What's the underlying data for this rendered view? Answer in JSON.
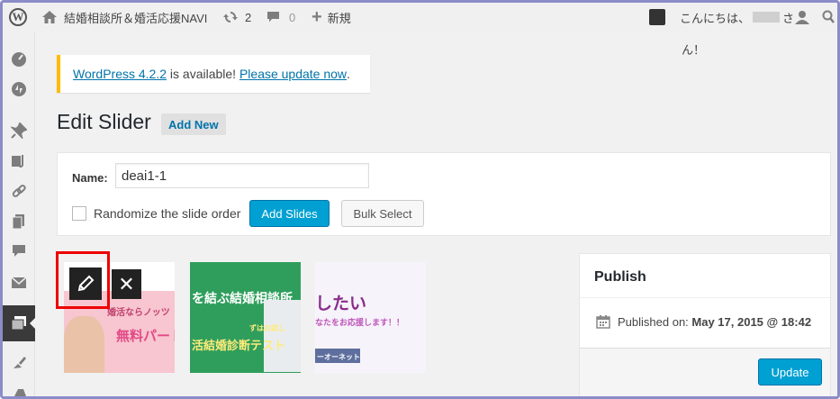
{
  "admin_bar": {
    "site_name": "結婚相談所＆婚活応援NAVI",
    "updates_count": "2",
    "comments_count": "0",
    "new_label": "新規",
    "greeting_prefix": "こんにちは、",
    "greeting_suffix": "さ",
    "greeting_wrap": "ん！"
  },
  "notice": {
    "version_link": "WordPress 4.2.2",
    "middle_text": " is available! ",
    "update_link": "Please update now",
    "end_text": "."
  },
  "page": {
    "title": "Edit Slider",
    "add_new_label": "Add New"
  },
  "settings": {
    "name_label": "Name:",
    "name_value": "deai1-1",
    "randomize_label": "Randomize the slide order",
    "randomize_checked": false,
    "add_slides_label": "Add Slides",
    "bulk_select_label": "Bulk Select"
  },
  "slides": [
    {
      "text_1": "婚活ならノッツ",
      "text_2": "無料パートナ"
    },
    {
      "text_1": "を結ぶ結婚相談所",
      "text_2": "ずはお試し",
      "text_3": "活結婚診断テスト"
    },
    {
      "text_1": "したい",
      "text_2": "なたをお応援します！！",
      "text_3": "ーオーネット"
    }
  ],
  "publish": {
    "title": "Publish",
    "published_label": "Published on:",
    "published_date": "May 17, 2015 @ 18:42",
    "update_label": "Update"
  },
  "colors": {
    "primary_button": "#00a0d2",
    "notice_border": "#ffba00",
    "highlight": "#ee0000",
    "link": "#0073aa"
  }
}
